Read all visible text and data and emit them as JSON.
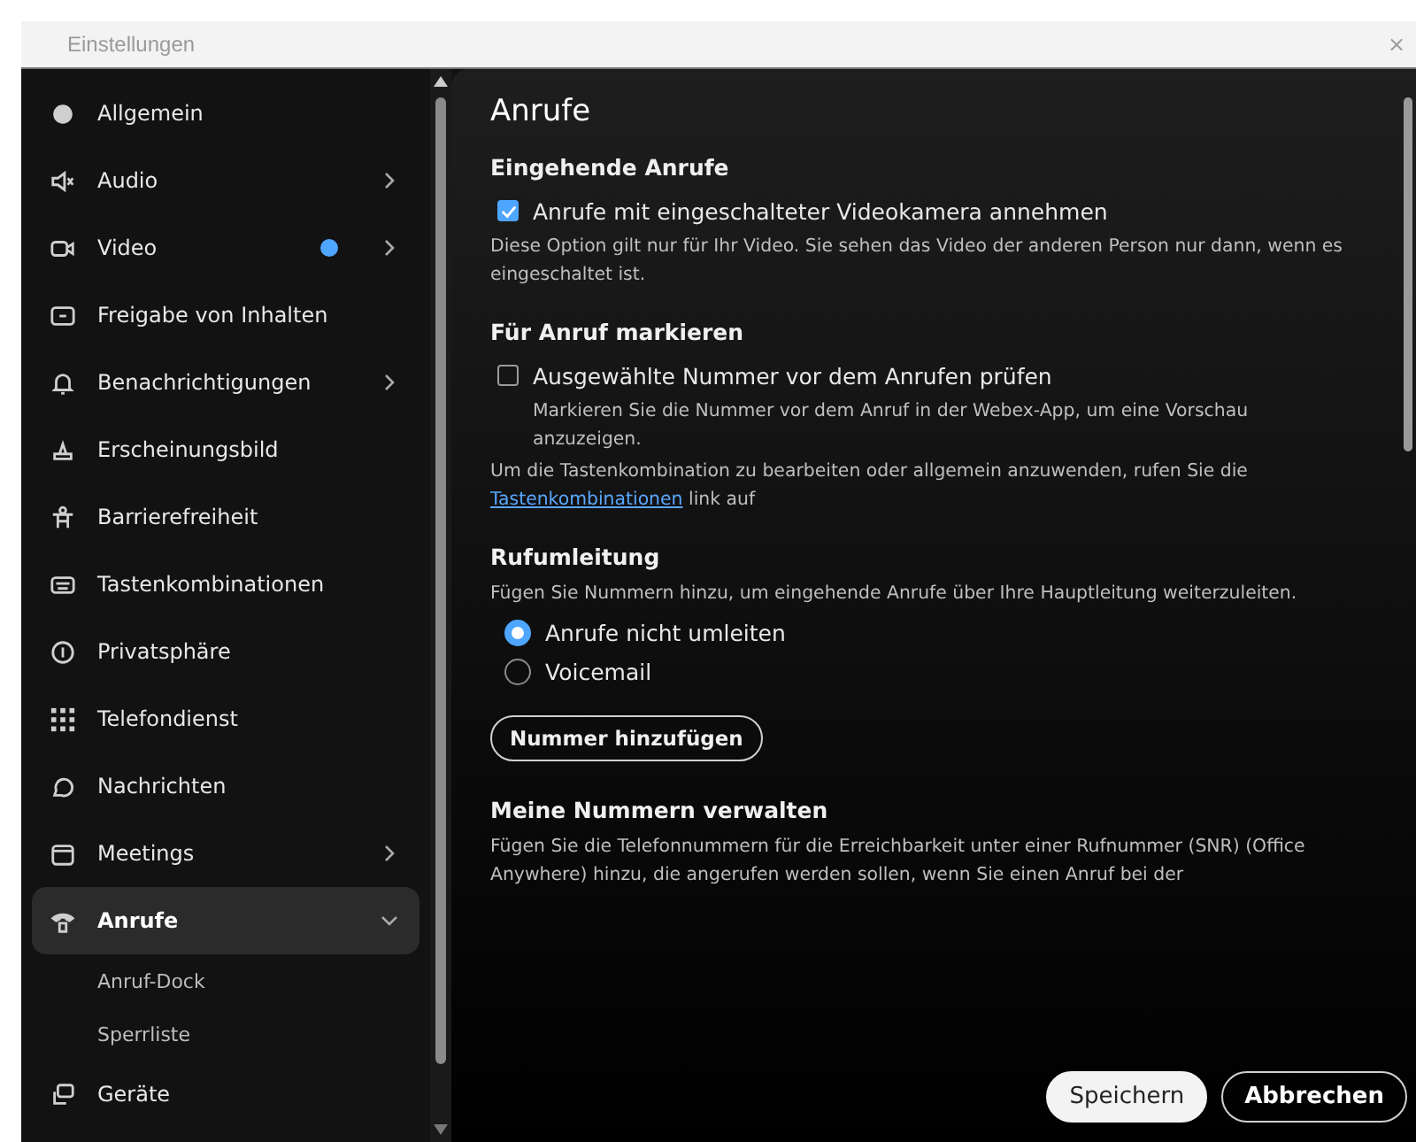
{
  "window": {
    "title": "Einstellungen",
    "close": "×"
  },
  "sidebar": {
    "items": [
      {
        "label": "Allgemein",
        "selected": false,
        "chevron": false,
        "dot": false
      },
      {
        "label": "Audio",
        "selected": false,
        "chevron": true,
        "dot": false
      },
      {
        "label": "Video",
        "selected": false,
        "chevron": true,
        "dot": true
      },
      {
        "label": "Freigabe von Inhalten",
        "selected": false,
        "chevron": false,
        "dot": false
      },
      {
        "label": "Benachrichtigungen",
        "selected": false,
        "chevron": true,
        "dot": false
      },
      {
        "label": "Erscheinungsbild",
        "selected": false,
        "chevron": false,
        "dot": false
      },
      {
        "label": "Barrierefreiheit",
        "selected": false,
        "chevron": false,
        "dot": false
      },
      {
        "label": "Tastenkombinationen",
        "selected": false,
        "chevron": false,
        "dot": false
      },
      {
        "label": "Privatsphäre",
        "selected": false,
        "chevron": false,
        "dot": false
      },
      {
        "label": "Telefondienst",
        "selected": false,
        "chevron": false,
        "dot": false
      },
      {
        "label": "Nachrichten",
        "selected": false,
        "chevron": false,
        "dot": false
      },
      {
        "label": "Meetings",
        "selected": false,
        "chevron": true,
        "dot": false
      },
      {
        "label": "Anrufe",
        "selected": true,
        "chevron": true,
        "dot": false,
        "expanded": true,
        "children": [
          {
            "label": "Anruf-Dock",
            "selected": false
          },
          {
            "label": "Sperrliste",
            "selected": false
          }
        ]
      },
      {
        "label": "Geräte",
        "selected": false,
        "chevron": false,
        "dot": false
      }
    ]
  },
  "content": {
    "title": "Anrufe",
    "blocks": [
      {
        "kind": "heading",
        "text": "Eingehende Anrufe"
      },
      {
        "kind": "checkbox",
        "label": "Anrufe mit eingeschalteter Videokamera annehmen",
        "checked": true
      },
      {
        "kind": "note",
        "text": "Diese Option gilt nur für Ihr Video. Sie sehen das Video der anderen Person nur dann, wenn es eingeschaltet ist."
      },
      {
        "kind": "heading",
        "text": "Für Anruf markieren"
      },
      {
        "kind": "checkbox",
        "label": "Ausgewählte Nummer vor dem Anrufen prüfen",
        "checked": false
      },
      {
        "kind": "subnote",
        "text": "Markieren Sie die Nummer vor dem Anruf in der Webex-App, um eine Vorschau anzuzeigen."
      },
      {
        "kind": "linknote",
        "before": "Um die Tastenkombination zu bearbeiten oder allgemein anzuwenden, rufen Sie die",
        "link": "Tastenkombinationen",
        "after": "link auf"
      },
      {
        "kind": "heading",
        "text": "Rufumleitung"
      },
      {
        "kind": "note",
        "text": "Fügen Sie Nummern hinzu, um eingehende Anrufe über Ihre Hauptleitung weiterzuleiten."
      },
      {
        "kind": "radio",
        "label": "Anrufe nicht umleiten",
        "selected": true
      },
      {
        "kind": "radio",
        "label": "Voicemail",
        "selected": false
      },
      {
        "kind": "button",
        "label": "Nummer hinzufügen"
      },
      {
        "kind": "heading",
        "text": "Meine Nummern verwalten"
      },
      {
        "kind": "note",
        "text": "Fügen Sie die Telefonnummern für die Erreichbarkeit unter einer Rufnummer (SNR) (Office Anywhere) hinzu, die angerufen werden sollen, wenn Sie einen Anruf bei der"
      }
    ]
  },
  "footer": {
    "buttons": [
      {
        "label": "Speichern",
        "primary": true
      },
      {
        "label": "Abbrechen",
        "primary": false
      }
    ]
  }
}
